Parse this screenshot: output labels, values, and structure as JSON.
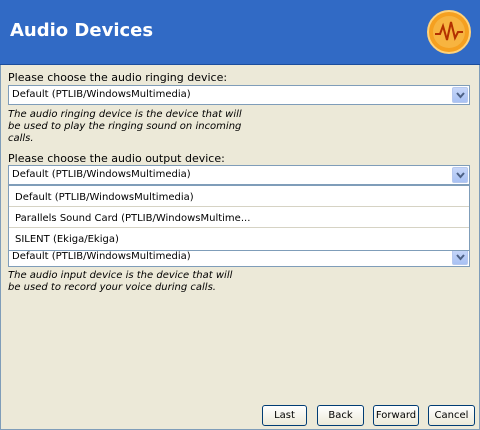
{
  "header": {
    "title": "Audio Devices",
    "logo_icon": "ekiga-logo-icon"
  },
  "ringing": {
    "label": "Please choose the audio ringing device:",
    "value": "Default (PTLIB/WindowsMultimedia)",
    "help_line1": "The audio ringing device is the device that will",
    "help_line2": "be used to play the ringing sound on incoming calls."
  },
  "output": {
    "label": "Please choose the audio output device:",
    "value": "Default (PTLIB/WindowsMultimedia)",
    "options": [
      "Default (PTLIB/WindowsMultimedia)",
      "Parallels Sound Card (PTLIB/WindowsMultime...",
      "SILENT (Ekiga/Ekiga)"
    ]
  },
  "input": {
    "value": "Default (PTLIB/WindowsMultimedia)",
    "help_line1": "The audio input device is the device that will",
    "help_line2": "be used to record your voice during calls."
  },
  "buttons": {
    "last": "Last",
    "back": "Back",
    "forward": "Forward",
    "cancel": "Cancel"
  },
  "colors": {
    "header_bg": "#316ac5",
    "window_bg": "#ece9d8",
    "logo_orange": "#f5a020"
  }
}
